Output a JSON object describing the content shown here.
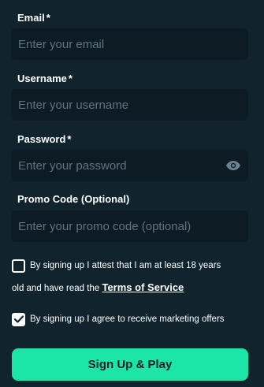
{
  "email": {
    "label": "Email",
    "required_mark": "*",
    "placeholder": "Enter your email"
  },
  "username": {
    "label": "Username",
    "required_mark": "*",
    "placeholder": "Enter your username"
  },
  "password": {
    "label": "Password",
    "required_mark": "*",
    "placeholder": "Enter your password",
    "toggle_icon": "eye-icon"
  },
  "promo": {
    "label": "Promo Code (Optional)",
    "placeholder": "Enter your promo code (optional)"
  },
  "age_consent": {
    "checked": false,
    "text_line1": "By signing up I attest that I am at least 18 years",
    "text_line2": "old and have read the",
    "link_text": "Terms of Service"
  },
  "marketing_consent": {
    "checked": true,
    "text": "By signing up I agree to receive marketing offers"
  },
  "submit_label": "Sign Up & Play",
  "colors": {
    "background": "#11242e",
    "field": "#0c1b24",
    "accent": "#1ce5a8"
  }
}
